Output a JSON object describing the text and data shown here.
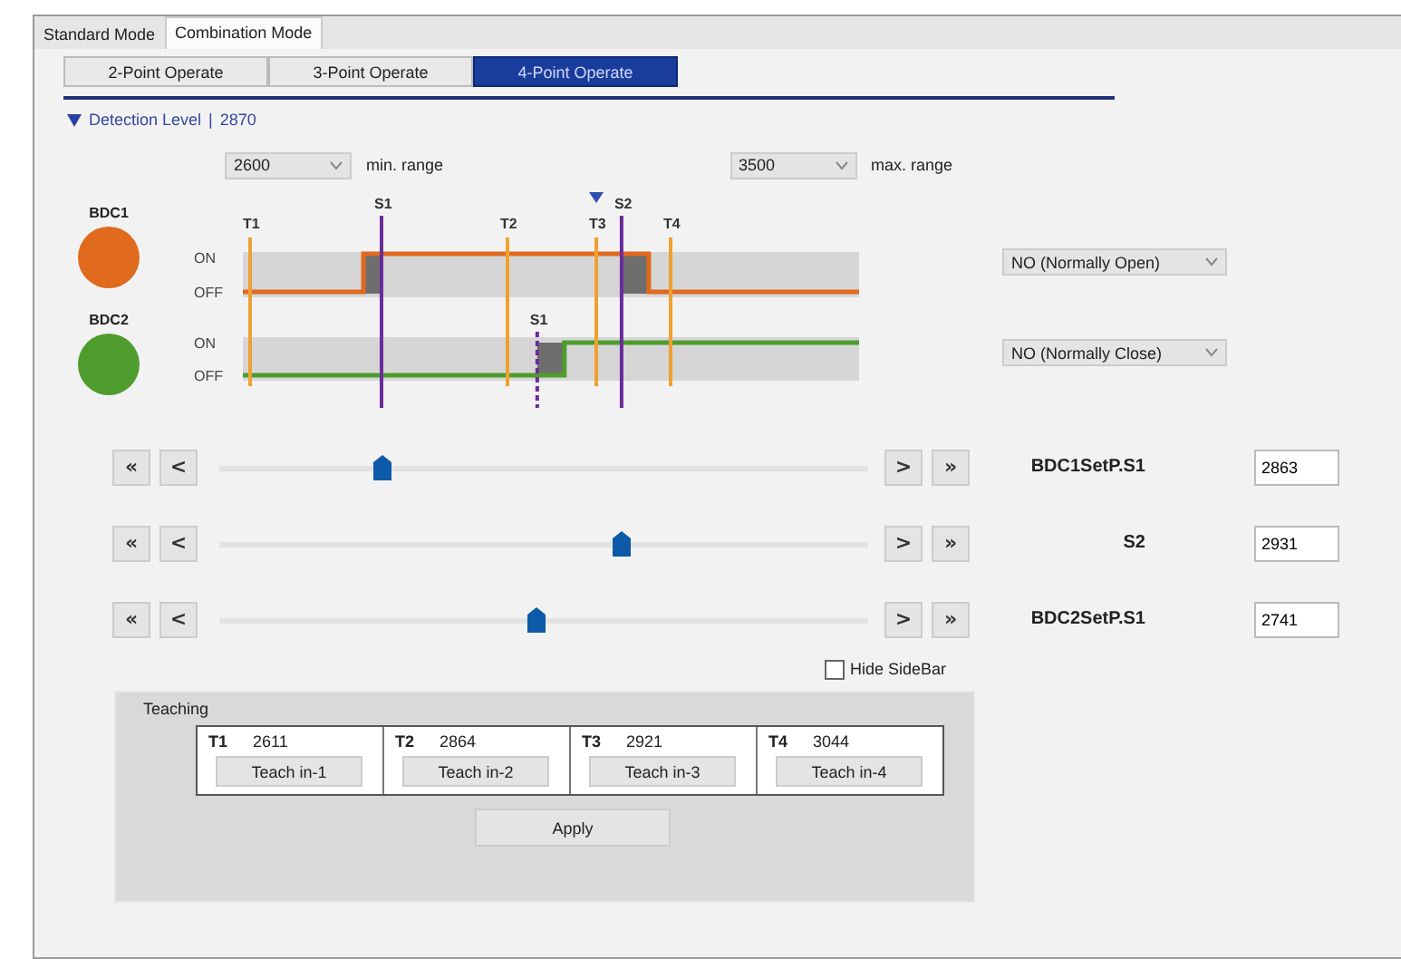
{
  "mode_tabs": [
    {
      "label": "Standard Mode",
      "selected": false
    },
    {
      "label": "Combination Mode",
      "selected": true
    }
  ],
  "operate_tabs": [
    {
      "label": "2-Point Operate",
      "selected": false
    },
    {
      "label": "3-Point Operate",
      "selected": false
    },
    {
      "label": "4-Point Operate",
      "selected": true
    }
  ],
  "detection_level": {
    "expanded": true,
    "label": "Detection Level",
    "separator": "|",
    "value": "2870"
  },
  "range": {
    "min": {
      "value": "2600",
      "label": "min. range"
    },
    "max": {
      "value": "3500",
      "label": "max. range"
    }
  },
  "outputs": [
    {
      "name": "BDC1",
      "color": "#e06a1e",
      "on_label": "ON",
      "off_label": "OFF",
      "marks": [
        "S1",
        "S2"
      ],
      "mode": "NO (Normally Open)"
    },
    {
      "name": "BDC2",
      "color": "#4e9c2e",
      "on_label": "ON",
      "off_label": "OFF",
      "marks": [
        "S1"
      ],
      "mode": "NO (Normally Close)"
    }
  ],
  "time_marks": [
    "T1",
    "T2",
    "T3",
    "T4"
  ],
  "sliders": [
    {
      "buttons": [
        "«",
        "<",
        ">",
        "»"
      ],
      "label": "BDC1SetP.S1",
      "level": 0.25,
      "value": "2863"
    },
    {
      "buttons": [
        "«",
        "<",
        ">",
        "»"
      ],
      "label": "S2",
      "level": 0.62,
      "value": "2931"
    },
    {
      "buttons": [
        "«",
        "<",
        ">",
        "»"
      ],
      "label": "BDC2SetP.S1",
      "level": 0.49,
      "value": "2741"
    }
  ],
  "hide_sidebar": {
    "label": "Hide SideBar",
    "checked": false
  },
  "teaching": {
    "title": "Teaching",
    "points": [
      {
        "name": "T1",
        "value": "2611",
        "button": "Teach in-1"
      },
      {
        "name": "T2",
        "value": "2864",
        "button": "Teach in-2"
      },
      {
        "name": "T3",
        "value": "2921",
        "button": "Teach in-3"
      },
      {
        "name": "T4",
        "value": "3044",
        "button": "Teach in-4"
      }
    ],
    "apply": "Apply"
  }
}
